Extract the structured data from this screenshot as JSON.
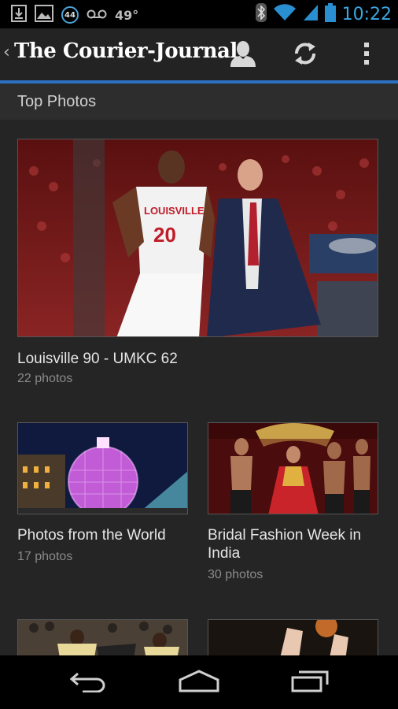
{
  "status_bar": {
    "notification_badge": "44",
    "temperature": "49°",
    "time": "10:22"
  },
  "action_bar": {
    "title": "The Courier-Journal",
    "back_glyph": "‹"
  },
  "section": {
    "title": "Top Photos"
  },
  "galleries": [
    {
      "title": "Louisville 90 - UMKC 62",
      "count": "22 photos"
    },
    {
      "title": "Photos from the World",
      "count": "17 photos"
    },
    {
      "title": "Bridal Fashion Week in India",
      "count": "30 photos"
    }
  ],
  "icons": {
    "download": "download-icon",
    "gallery": "gallery-icon",
    "voicemail": "voicemail-icon",
    "bluetooth": "bluetooth-icon",
    "wifi": "wifi-icon",
    "signal": "signal-icon",
    "battery": "battery-icon",
    "account": "account-icon",
    "refresh": "refresh-icon",
    "overflow": "overflow-menu-icon",
    "back": "back-icon",
    "home": "home-icon",
    "recents": "recents-icon"
  },
  "colors": {
    "accent_blue": "#2b71c2",
    "clock_blue": "#3aa7e4",
    "background": "#252525"
  }
}
